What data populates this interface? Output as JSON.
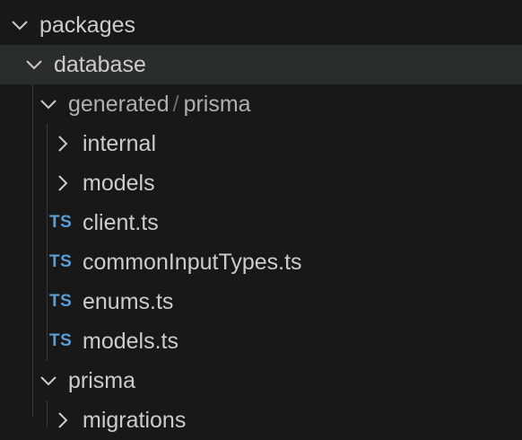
{
  "explorer": {
    "items": [
      {
        "label": "packages",
        "chevron": "chevron-down-icon"
      },
      {
        "label": "database",
        "chevron": "chevron-down-icon"
      },
      {
        "label_part1": "generated",
        "separator": "/",
        "label_part2": "prisma",
        "chevron": "chevron-down-icon"
      },
      {
        "label": "internal",
        "chevron": "chevron-right-icon"
      },
      {
        "label": "models",
        "chevron": "chevron-right-icon"
      },
      {
        "label": "client.ts",
        "badge": "TS",
        "icon": "typescript-file-icon"
      },
      {
        "label": "commonInputTypes.ts",
        "badge": "TS",
        "icon": "typescript-file-icon"
      },
      {
        "label": "enums.ts",
        "badge": "TS",
        "icon": "typescript-file-icon"
      },
      {
        "label": "models.ts",
        "badge": "TS",
        "icon": "typescript-file-icon"
      },
      {
        "label": "prisma",
        "chevron": "chevron-down-icon"
      },
      {
        "label": "migrations",
        "chevron": "chevron-right-icon"
      }
    ]
  },
  "colors": {
    "background": "#181818",
    "selected_row": "#2a2d2e",
    "text": "#cccccc",
    "typescript_badge": "#5a9fd4",
    "indent_guide": "#3a3a3a"
  }
}
